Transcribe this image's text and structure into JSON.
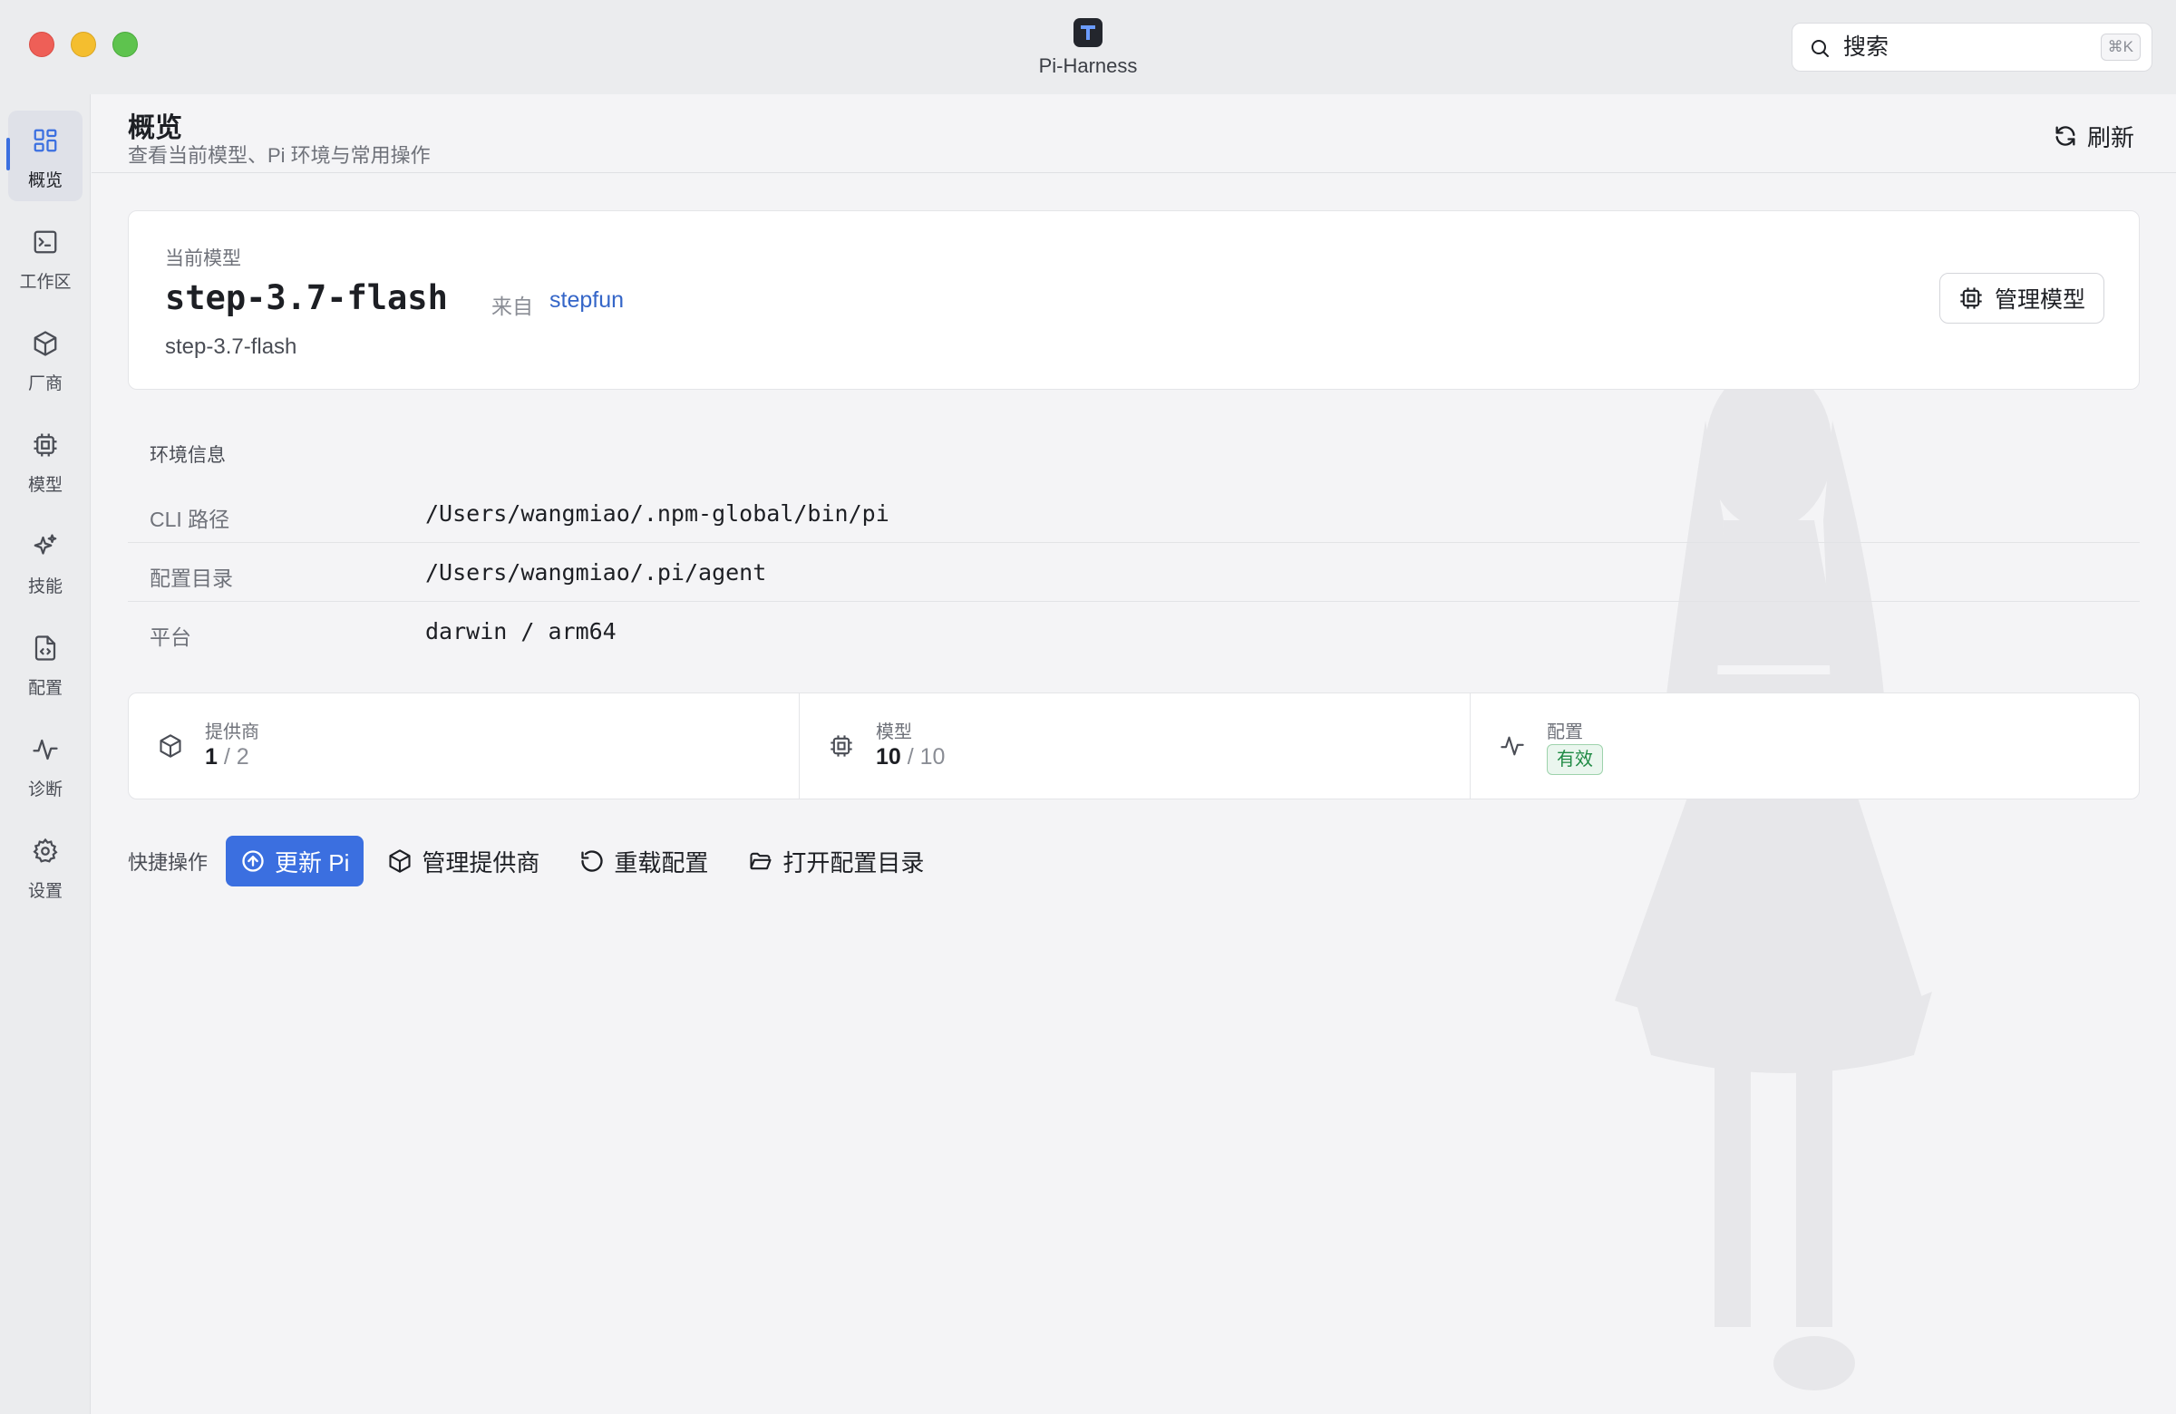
{
  "app": {
    "title": "Pi-Harness"
  },
  "search": {
    "placeholder": "搜索",
    "shortcut": "⌘K"
  },
  "sidebar": {
    "items": [
      {
        "label": "概览",
        "icon": "grid-icon",
        "active": true
      },
      {
        "label": "工作区",
        "icon": "terminal-icon"
      },
      {
        "label": "厂商",
        "icon": "cube-icon"
      },
      {
        "label": "模型",
        "icon": "chip-icon"
      },
      {
        "label": "技能",
        "icon": "sparkles-icon"
      },
      {
        "label": "配置",
        "icon": "file-code-icon"
      },
      {
        "label": "诊断",
        "icon": "activity-icon"
      },
      {
        "label": "设置",
        "icon": "gear-icon"
      }
    ]
  },
  "header": {
    "title": "概览",
    "subtitle": "查看当前模型、Pi 环境与常用操作",
    "refresh_label": "刷新"
  },
  "current_model": {
    "label": "当前模型",
    "name": "step-3.7-flash",
    "from_label": "来自",
    "provider": "stepfun",
    "id": "step-3.7-flash",
    "manage_label": "管理模型"
  },
  "environment": {
    "title": "环境信息",
    "rows": [
      {
        "key": "CLI 路径",
        "value": "/Users/wangmiao/.npm-global/bin/pi"
      },
      {
        "key": "配置目录",
        "value": "/Users/wangmiao/.pi/agent"
      },
      {
        "key": "平台",
        "value": "darwin / arm64"
      }
    ]
  },
  "stats": {
    "providers": {
      "label": "提供商",
      "current": "1",
      "total": "/ 2"
    },
    "models": {
      "label": "模型",
      "current": "10",
      "total": "/ 10"
    },
    "config": {
      "label": "配置",
      "status": "有效",
      "status_color": "#1f8a44"
    }
  },
  "quick_actions": {
    "label": "快捷操作",
    "update": "更新 Pi",
    "manage_providers": "管理提供商",
    "reload_config": "重载配置",
    "open_config_dir": "打开配置目录"
  },
  "colors": {
    "accent": "#3b6fe0",
    "link": "#3566c8"
  }
}
